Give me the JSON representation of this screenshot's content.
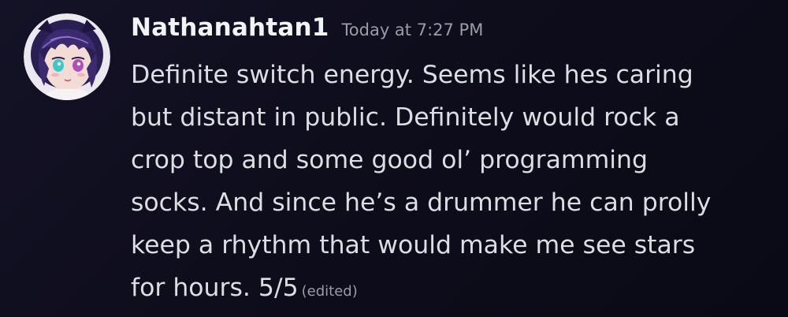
{
  "message": {
    "username": "Nathanahtan1",
    "timestamp": "Today at 7:27 PM",
    "content_lines": [
      "Definite switch energy. Seems like hes caring",
      "but distant in public. Definitely would rock a",
      "crop top and some good ol’ programming",
      "socks. And since he’s a drummer he can prolly",
      "keep a rhythm that would make me see stars",
      "for hours. 5/5"
    ],
    "edited_label": "(edited)"
  },
  "colors": {
    "background": "#0e0d1c",
    "username": "#f2f3f5",
    "text": "#dcdee3",
    "muted": "#9a9ca6",
    "avatar_hair": "#3b2a6e",
    "avatar_skin": "#f4dcd6"
  }
}
